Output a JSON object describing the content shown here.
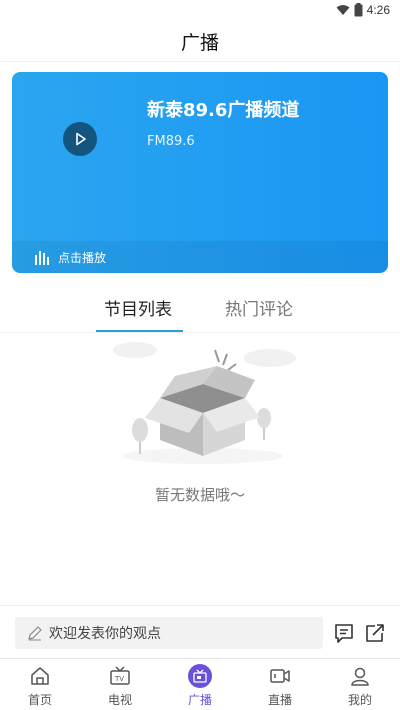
{
  "status_bar": {
    "time": "4:26"
  },
  "header": {
    "title": "广播"
  },
  "player": {
    "station_name": "新泰89.6广播频道",
    "frequency": "FM89.6",
    "play_label": "点击播放"
  },
  "tabs": [
    {
      "label": "节目列表",
      "active": true
    },
    {
      "label": "热门评论",
      "active": false
    }
  ],
  "empty_state": {
    "message": "暂无数据哦～"
  },
  "comment_bar": {
    "placeholder": "欢迎发表你的观点"
  },
  "bottom_nav": {
    "items": [
      {
        "label": "首页",
        "icon": "home-icon"
      },
      {
        "label": "电视",
        "icon": "tv-icon"
      },
      {
        "label": "广播",
        "icon": "radio-icon",
        "active": true
      },
      {
        "label": "直播",
        "icon": "live-camera-icon"
      },
      {
        "label": "我的",
        "icon": "profile-icon"
      }
    ]
  },
  "colors": {
    "card_gradient_start": "#2aa6f0",
    "card_gradient_end": "#1b96f3",
    "play_button": "#14557f",
    "tab_indicator": "#2aa0c8",
    "nav_active": "#6a51d8"
  }
}
